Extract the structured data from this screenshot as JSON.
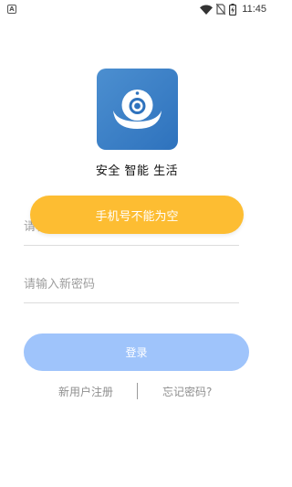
{
  "status_bar": {
    "time": "11:45",
    "notification_icon_letter": "A",
    "icons": [
      "wifi-icon",
      "no-sim-icon",
      "battery-charging-icon"
    ]
  },
  "app": {
    "name": "安全 智能 生活",
    "logo_icon": "camera-logo-icon",
    "logo_colors": [
      "#4c8fd0",
      "#2e72bd"
    ]
  },
  "form": {
    "phone_placeholder": "请输入手机号",
    "phone_value": "",
    "password_placeholder": "请输入新密码",
    "password_value": ""
  },
  "toast": {
    "message": "手机号不能为空",
    "color": "#fdbd32"
  },
  "login_button": {
    "label": "登录",
    "color": "#9fc4fb"
  },
  "links": {
    "register": "新用户注册",
    "forgot_password": "忘记密码?"
  }
}
